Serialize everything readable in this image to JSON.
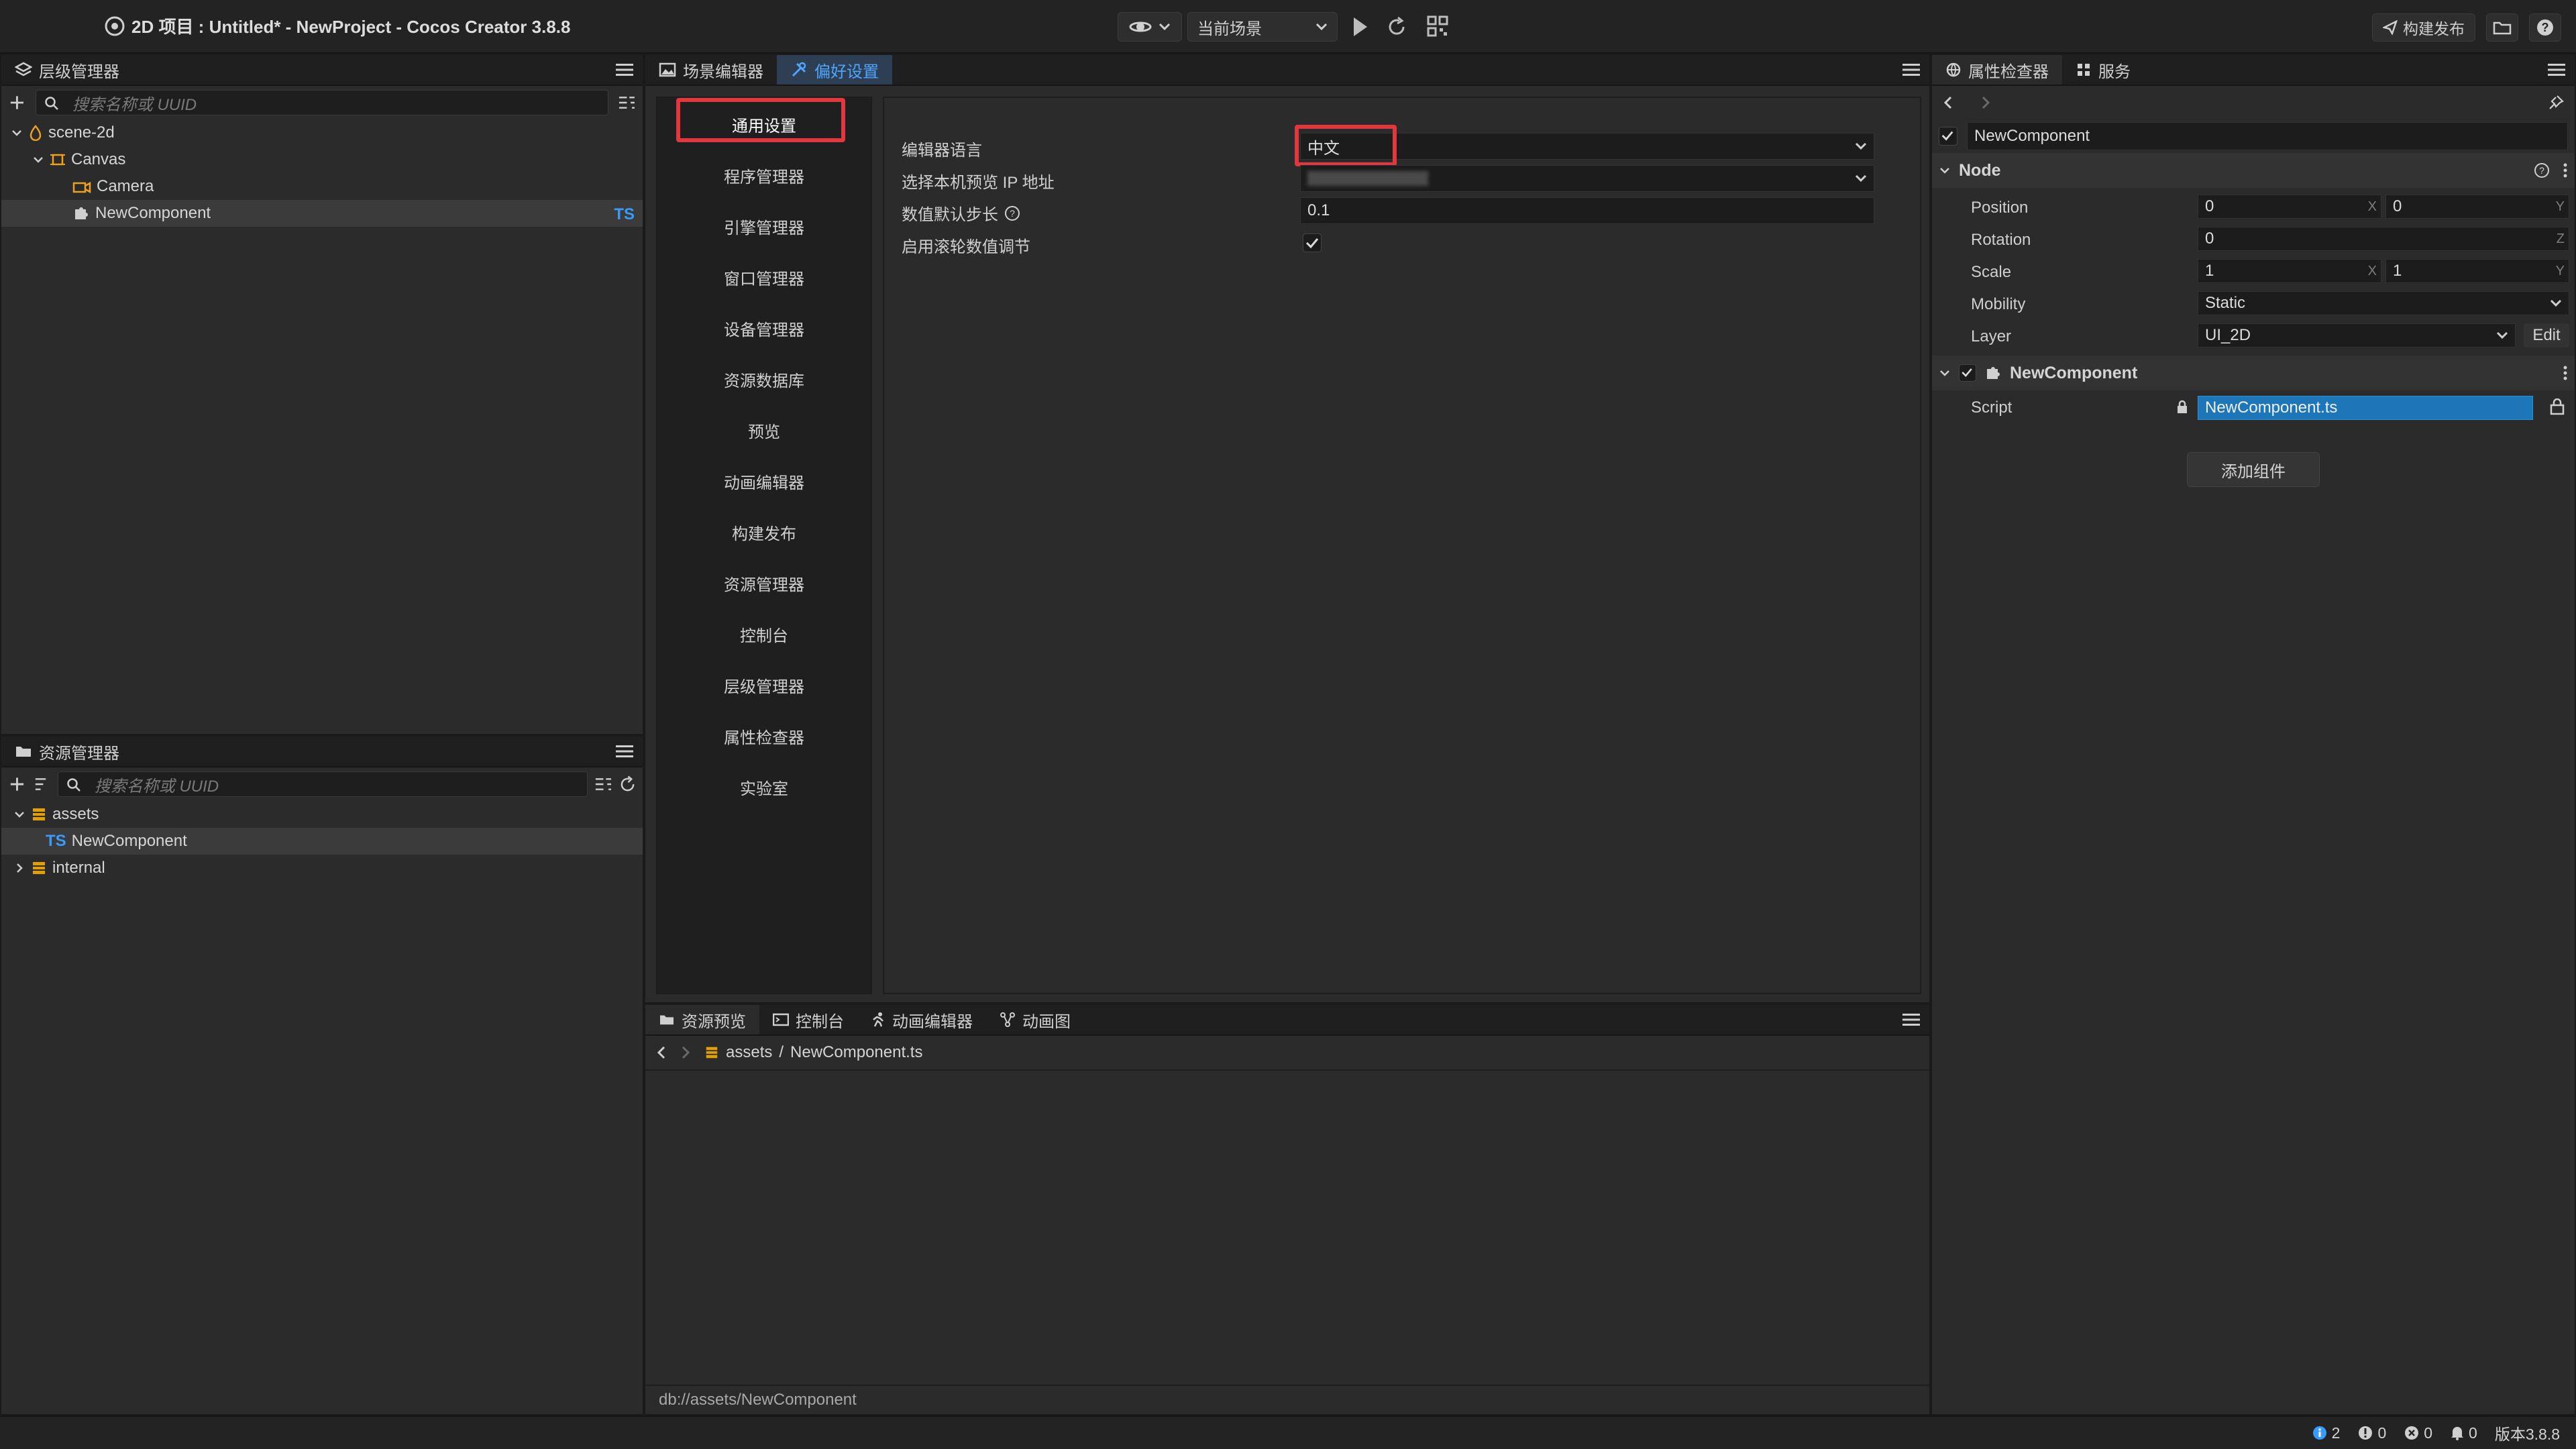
{
  "titlebar": {
    "title": "2D 项目 : Untitled* - NewProject - Cocos Creator 3.8.8",
    "scene_select": "当前场景",
    "build_label": "构建发布"
  },
  "hierarchy": {
    "tab_label": "层级管理器",
    "search_placeholder": "搜索名称或 UUID",
    "nodes": {
      "scene": "scene-2d",
      "canvas": "Canvas",
      "camera": "Camera",
      "component": "NewComponent",
      "ts_badge": "TS"
    }
  },
  "assets": {
    "tab_label": "资源管理器",
    "search_placeholder": "搜索名称或 UUID",
    "items": {
      "assets": "assets",
      "newcomponent": "NewComponent",
      "ts_badge": "TS",
      "internal": "internal"
    }
  },
  "center_tabs": {
    "scene_editor": "场景编辑器",
    "preferences": "偏好设置"
  },
  "preferences": {
    "nav": [
      "通用设置",
      "程序管理器",
      "引擎管理器",
      "窗口管理器",
      "设备管理器",
      "资源数据库",
      "预览",
      "动画编辑器",
      "构建发布",
      "资源管理器",
      "控制台",
      "层级管理器",
      "属性检查器",
      "实验室"
    ],
    "fields": {
      "language_label": "编辑器语言",
      "language_value": "中文",
      "ip_label": "选择本机预览 IP 地址",
      "step_label": "数值默认步长",
      "step_value": "0.1",
      "wheel_label": "启用滚轮数值调节",
      "wheel_checked": true
    }
  },
  "bottom_panel": {
    "tabs": [
      "资源预览",
      "控制台",
      "动画编辑器",
      "动画图"
    ],
    "breadcrumb_root": "assets",
    "breadcrumb_sep": "/",
    "breadcrumb_file": "NewComponent.ts",
    "status_path": "db://assets/NewComponent"
  },
  "inspector": {
    "tab_label": "属性检查器",
    "services_label": "服务",
    "node_name": "NewComponent",
    "node_section": "Node",
    "position": {
      "label": "Position",
      "x": "0",
      "y": "0",
      "x_axis": "X",
      "y_axis": "Y"
    },
    "rotation": {
      "label": "Rotation",
      "z": "0",
      "z_axis": "Z"
    },
    "scale": {
      "label": "Scale",
      "x": "1",
      "y": "1",
      "x_axis": "X",
      "y_axis": "Y"
    },
    "mobility": {
      "label": "Mobility",
      "value": "Static"
    },
    "layer": {
      "label": "Layer",
      "value": "UI_2D",
      "edit": "Edit"
    },
    "component_section": "NewComponent",
    "script": {
      "label": "Script",
      "value": "NewComponent.ts"
    },
    "add_component": "添加组件"
  },
  "statusbar": {
    "info_count": "2",
    "warn_count": "0",
    "error_count": "0",
    "notify_count": "0",
    "version": "版本3.8.8"
  },
  "colors": {
    "accent": "#4ea6ff",
    "highlight_box": "#e0383e",
    "script_field": "#1c76b8"
  }
}
